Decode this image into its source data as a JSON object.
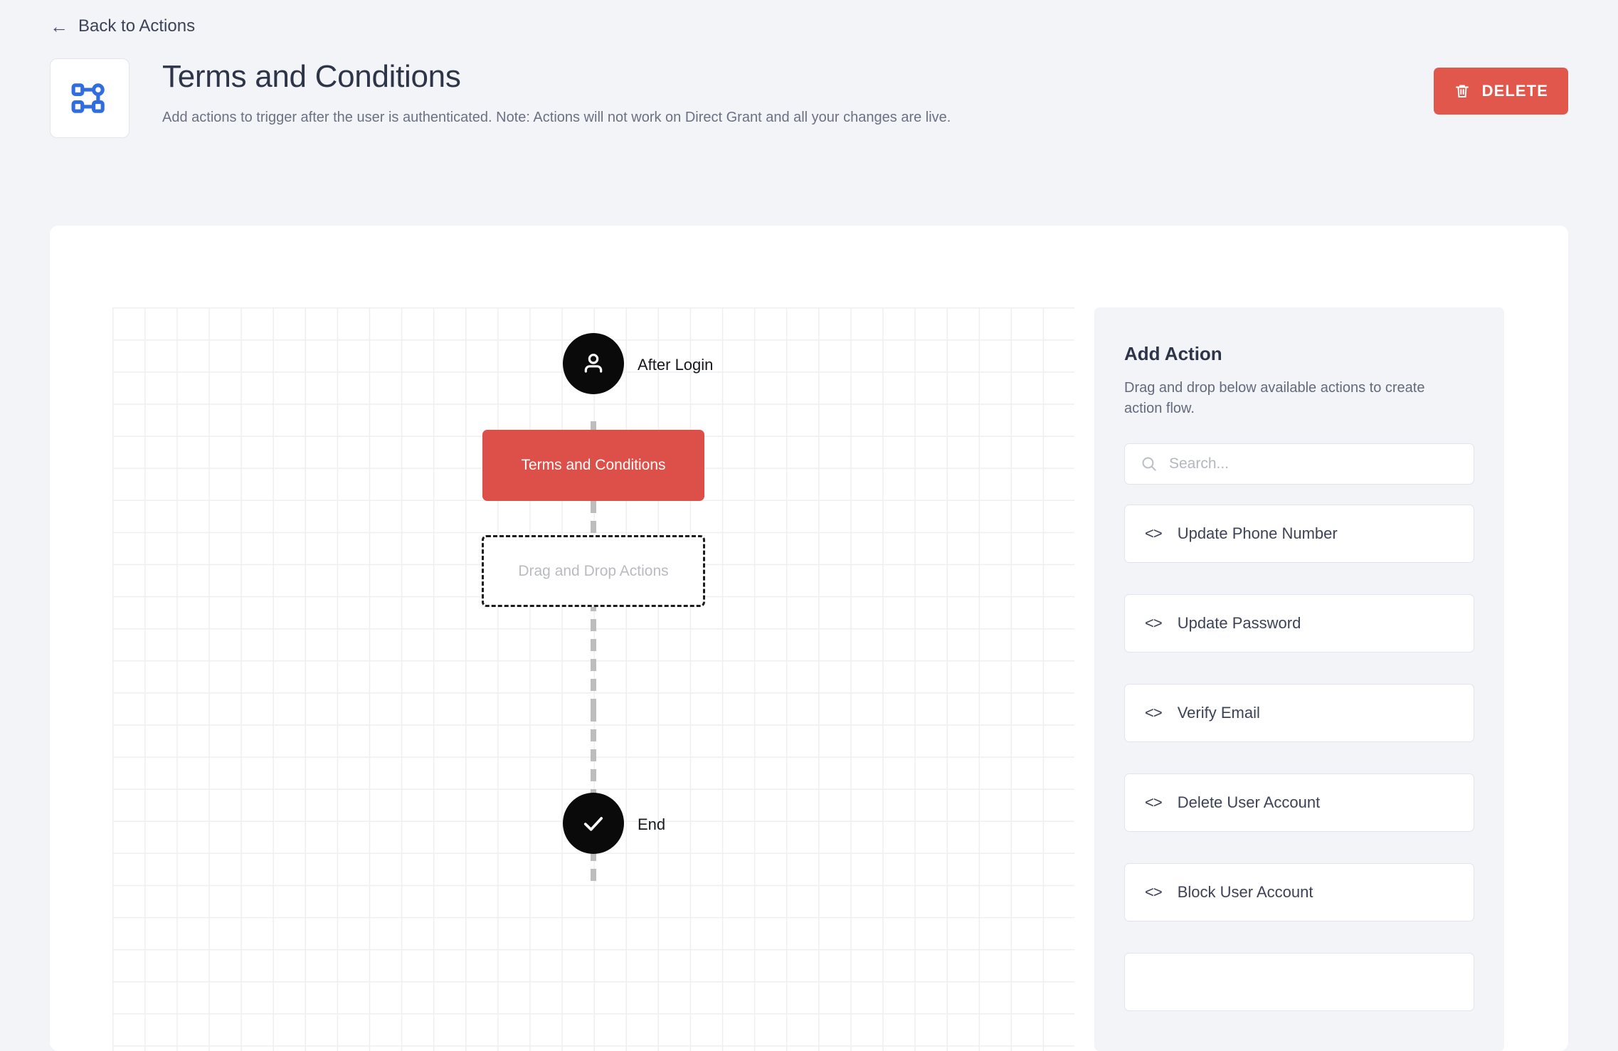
{
  "nav": {
    "back_label": "Back to Actions",
    "back_icon": "arrow-left-icon"
  },
  "header": {
    "icon": "flow-nodes-icon",
    "title": "Terms and Conditions",
    "subtitle": "Add actions to trigger after the user is authenticated. Note: Actions will not work on Direct Grant and all your changes are live.",
    "delete_label": "DELETE",
    "delete_icon": "trash-icon",
    "delete_color": "#e2574c"
  },
  "flow": {
    "start_node": {
      "label": "After Login",
      "icon": "user-icon",
      "color": "#0a0a0a"
    },
    "action_node": {
      "label": "Terms and Conditions",
      "color": "#dd5049"
    },
    "drop_zone": {
      "label": "Drag and Drop Actions"
    },
    "end_node": {
      "label": "End",
      "icon": "check-icon",
      "color": "#0a0a0a"
    }
  },
  "sidebar": {
    "title": "Add Action",
    "description": "Drag and drop below available actions to create action flow.",
    "search": {
      "placeholder": "Search...",
      "value": "",
      "icon": "search-icon"
    },
    "items": [
      {
        "label": "Update Phone Number",
        "icon": "code-icon"
      },
      {
        "label": "Update Password",
        "icon": "code-icon"
      },
      {
        "label": "Verify Email",
        "icon": "code-icon"
      },
      {
        "label": "Delete User Account",
        "icon": "code-icon"
      },
      {
        "label": "Block User Account",
        "icon": "code-icon"
      },
      {
        "label": "",
        "icon": "code-icon"
      }
    ]
  }
}
